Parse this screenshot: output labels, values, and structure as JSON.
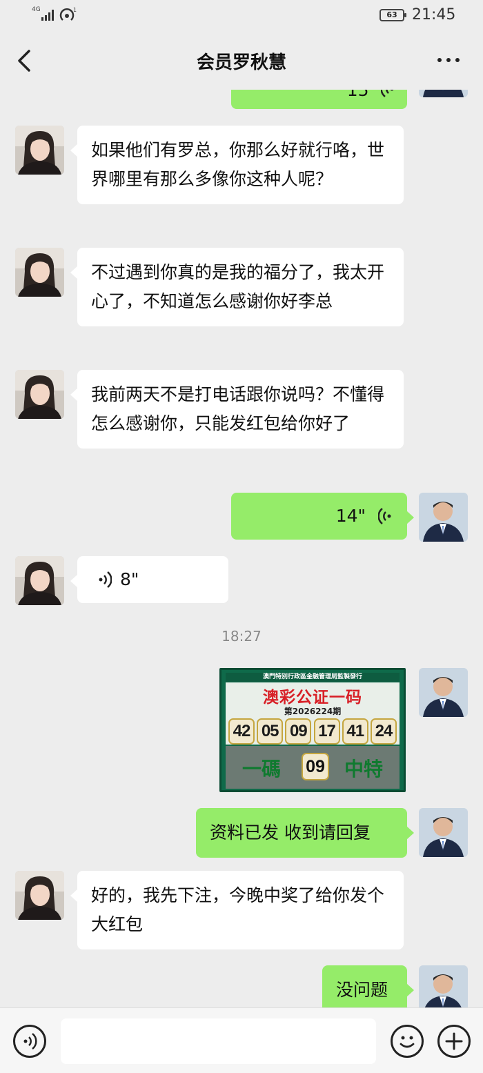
{
  "status_bar": {
    "network": "4G",
    "signal_sub": "1",
    "battery": "63",
    "time": "21:45"
  },
  "header": {
    "title": "会员罗秋慧"
  },
  "messages": [
    {
      "side": "right",
      "type": "voice",
      "duration": "15\""
    },
    {
      "side": "left",
      "type": "text",
      "text": "如果他们有罗总，你那么好就行咯，世界哪里有那么多像你这种人呢？"
    },
    {
      "side": "left",
      "type": "text",
      "text": "不过遇到你真的是我的福分了，我太开心了，不知道怎么感谢你好李总"
    },
    {
      "side": "left",
      "type": "text",
      "text": "我前两天不是打电话跟你说吗？不懂得怎么感谢你，只能发红包给你好了"
    },
    {
      "side": "right",
      "type": "voice",
      "duration": "14\""
    },
    {
      "side": "left",
      "type": "voice",
      "duration": "8\""
    },
    {
      "type": "time",
      "text": "18:27"
    },
    {
      "side": "right",
      "type": "image"
    },
    {
      "side": "right",
      "type": "text",
      "text": "资料已发 收到请回复"
    },
    {
      "side": "left",
      "type": "text",
      "text": "好的，我先下注，今晚中奖了给你发个大红包"
    },
    {
      "side": "right",
      "type": "text",
      "text": "没问题"
    }
  ],
  "lottery_card": {
    "issuer": "澳門特別行政區金融管理局監製發行",
    "title": "澳彩公证一码",
    "period": "第2026224期",
    "numbers": [
      "42",
      "05",
      "09",
      "17",
      "41",
      "24"
    ],
    "bottom_left": "一碼",
    "special": "09",
    "bottom_right": "中特"
  },
  "input_bar": {
    "voice_icon": "voice-icon",
    "emoji_icon": "emoji-icon",
    "plus_icon": "plus-icon"
  },
  "colors": {
    "background": "#ededed",
    "right_bubble": "#95ec69",
    "left_bubble": "#ffffff",
    "card_green": "#0f6a4a",
    "card_red": "#d81f26"
  }
}
